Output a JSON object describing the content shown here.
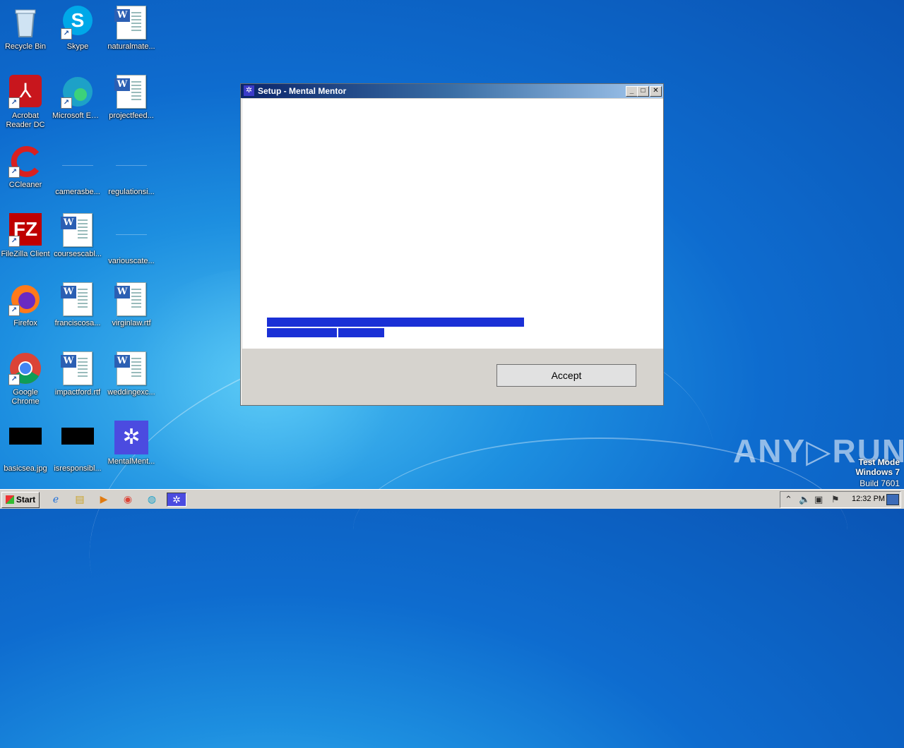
{
  "desktop": {
    "icons": [
      {
        "label": "Recycle Bin"
      },
      {
        "label": "Skype"
      },
      {
        "label": "naturalmate..."
      },
      {
        "label": "Acrobat Reader DC"
      },
      {
        "label": "Microsoft Edge"
      },
      {
        "label": "projectfeed..."
      },
      {
        "label": "CCleaner"
      },
      {
        "label": "camerasbe..."
      },
      {
        "label": "regulationsi..."
      },
      {
        "label": "FileZilla Client"
      },
      {
        "label": "coursescabl..."
      },
      {
        "label": "variouscate..."
      },
      {
        "label": "Firefox"
      },
      {
        "label": "franciscosa..."
      },
      {
        "label": "virginlaw.rtf"
      },
      {
        "label": "Google Chrome"
      },
      {
        "label": "impactford.rtf"
      },
      {
        "label": "weddingexc..."
      },
      {
        "label": "basicsea.jpg"
      },
      {
        "label": "isresponsibl..."
      },
      {
        "label": "MentalMent..."
      }
    ]
  },
  "window": {
    "title": "Setup - Mental Mentor",
    "accept_label": "Accept",
    "minimize": "_",
    "maximize": "□",
    "close": "✕"
  },
  "watermark": {
    "brand": "ANY▷RUN",
    "line1": "Test Mode",
    "line2": "Windows 7",
    "line3": "Build 7601"
  },
  "taskbar": {
    "start_label": "Start",
    "clock": "12:32 PM"
  },
  "colors": {
    "progress": "#1a30d6",
    "titlebar_start": "#0a246a",
    "titlebar_end": "#a6caf0"
  }
}
